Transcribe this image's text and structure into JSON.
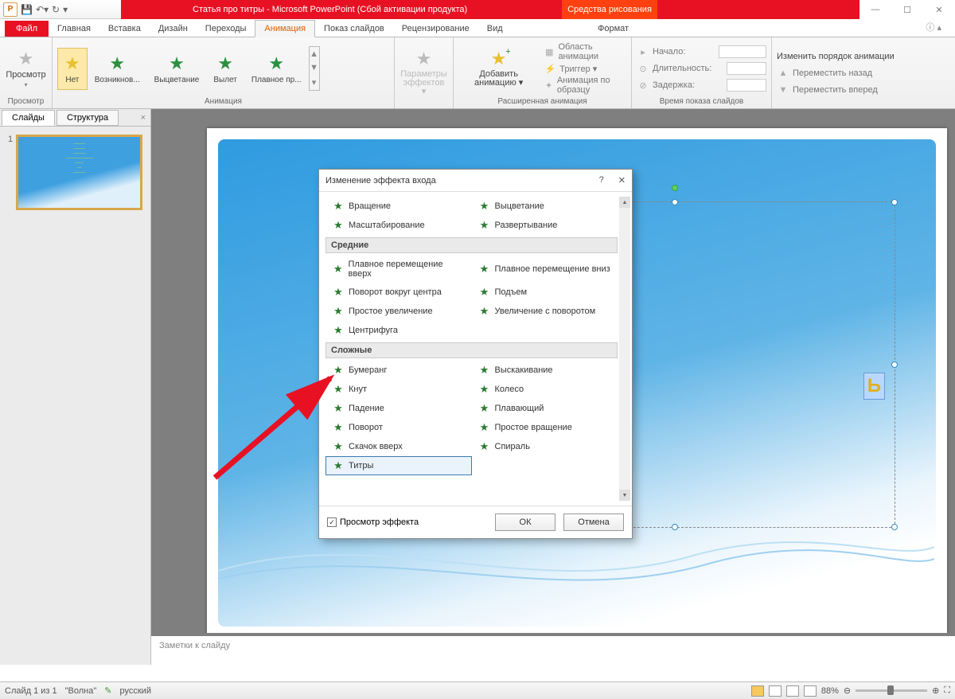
{
  "title": "Статья про титры  -  Microsoft PowerPoint (Сбой активации продукта)",
  "contextual_tab": "Средства рисования",
  "tabs": {
    "file": "Файл",
    "home": "Главная",
    "insert": "Вставка",
    "design": "Дизайн",
    "transitions": "Переходы",
    "animation": "Анимация",
    "slideshow": "Показ слайдов",
    "review": "Рецензирование",
    "view": "Вид",
    "format": "Формат",
    "help": "ˆ"
  },
  "ribbon": {
    "preview": {
      "label": "Просмотр",
      "btn": "Просмотр",
      "drop": "▾"
    },
    "animation": {
      "label": "Анимация",
      "items": [
        "Нет",
        "Возникнов...",
        "Выцветание",
        "Вылет",
        "Плавное пр..."
      ]
    },
    "effects": "Параметры эффектов ▾",
    "add": "Добавить анимацию ▾",
    "ext": {
      "label": "Расширенная анимация",
      "pane": "Область анимации",
      "trigger": "Триггер ▾",
      "painter": "Анимация по образцу"
    },
    "timing": {
      "label": "Время показа слайдов",
      "start": "Начало:",
      "dur": "Длительность:",
      "delay": "Задержка:"
    },
    "reorder": {
      "title": "Изменить порядок анимации",
      "back": "Переместить назад",
      "fwd": "Переместить вперед"
    }
  },
  "side": {
    "slides": "Слайды",
    "structure": "Структура",
    "num": "1"
  },
  "notes": "Заметки к слайду",
  "status": {
    "slide": "Слайд 1 из 1",
    "theme": "\"Волна\"",
    "lang": "русский",
    "zoom": "88%"
  },
  "dialog": {
    "title": "Изменение эффекта входа",
    "row1": [
      "Вращение",
      "Выцветание",
      "Масштабирование",
      "Развертывание"
    ],
    "cat_mid": "Средние",
    "mid": [
      "Плавное перемещение вверх",
      "Плавное перемещение вниз",
      "Поворот вокруг центра",
      "Подъем",
      "Простое увеличение",
      "Увеличение с поворотом",
      "Центрифуга"
    ],
    "cat_cx": "Сложные",
    "cx": [
      "Бумеранг",
      "Выскакивание",
      "Кнут",
      "Колесо",
      "Падение",
      "Плавающий",
      "Поворот",
      "Простое вращение",
      "Скачок вверх",
      "Спираль",
      "Титры"
    ],
    "preview": "Просмотр эффекта",
    "ok": "ОК",
    "cancel": "Отмена"
  },
  "slidetxt": "Ь"
}
